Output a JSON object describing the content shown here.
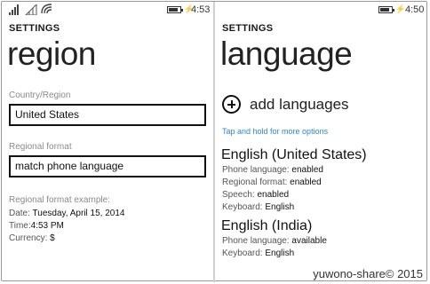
{
  "left": {
    "status_time": "4:53",
    "header": "SETTINGS",
    "title": "region",
    "country_label": "Country/Region",
    "country_value": "United States",
    "format_label": "Regional format",
    "format_value": "match phone language",
    "example_label": "Regional format example:",
    "example": [
      {
        "key": "Date:",
        "value": "Tuesday, April 15, 2014"
      },
      {
        "key": "Time:",
        "value": "4:53  PM"
      },
      {
        "key": "Currency:",
        "value": "$"
      }
    ]
  },
  "right": {
    "status_time": "4:50",
    "header": "SETTINGS",
    "title": "language",
    "add_label": "add languages",
    "hint": "Tap and hold for more options",
    "languages": [
      {
        "name": "English (United States)",
        "details": [
          {
            "key": "Phone language:",
            "value": "enabled"
          },
          {
            "key": "Regional format:",
            "value": "enabled"
          },
          {
            "key": "Speech:",
            "value": "enabled"
          },
          {
            "key": "Keyboard:",
            "value": "English"
          }
        ]
      },
      {
        "name": "English (India)",
        "details": [
          {
            "key": "Phone language:",
            "value": "available"
          },
          {
            "key": "Keyboard:",
            "value": "English"
          }
        ]
      }
    ]
  },
  "watermark": "yuwono-share© 2015"
}
